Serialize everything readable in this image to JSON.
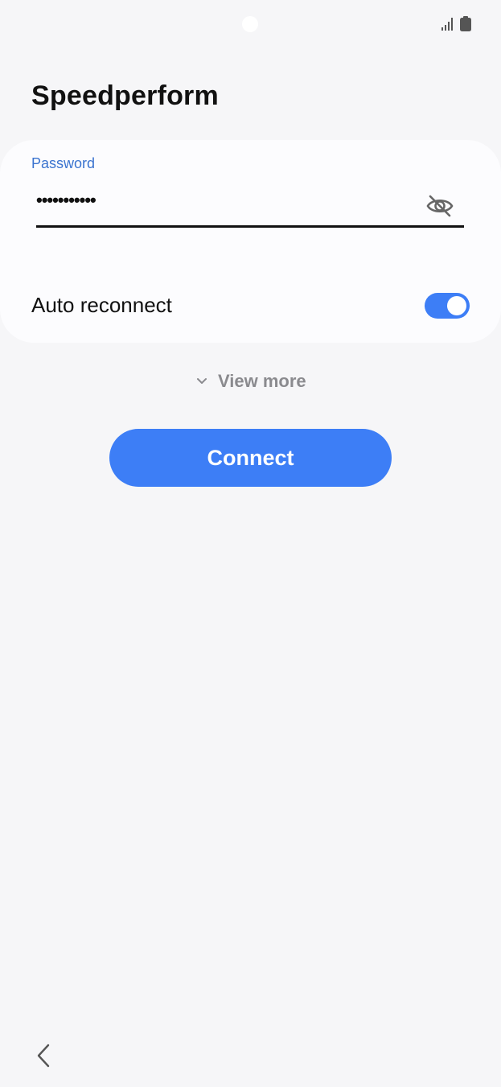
{
  "app": {
    "title": "Speedperform"
  },
  "status_bar": {
    "icons": [
      "camera-cutout",
      "signal-icon",
      "battery-icon"
    ]
  },
  "form": {
    "password_label": "Password",
    "password_value": "•••••••••••",
    "visibility_icon": "eye-off-icon",
    "auto_reconnect_label": "Auto reconnect",
    "auto_reconnect_on": true
  },
  "view_more": {
    "label": "View more",
    "icon": "chevron-down-icon"
  },
  "actions": {
    "connect_label": "Connect"
  },
  "nav": {
    "back_icon": "back-chevron-icon"
  },
  "colors": {
    "accent": "#3d7ef6",
    "label_blue": "#3a73cf",
    "background": "#f6f6f8",
    "card": "#fcfcfe",
    "muted_text": "#8a8a8e"
  }
}
